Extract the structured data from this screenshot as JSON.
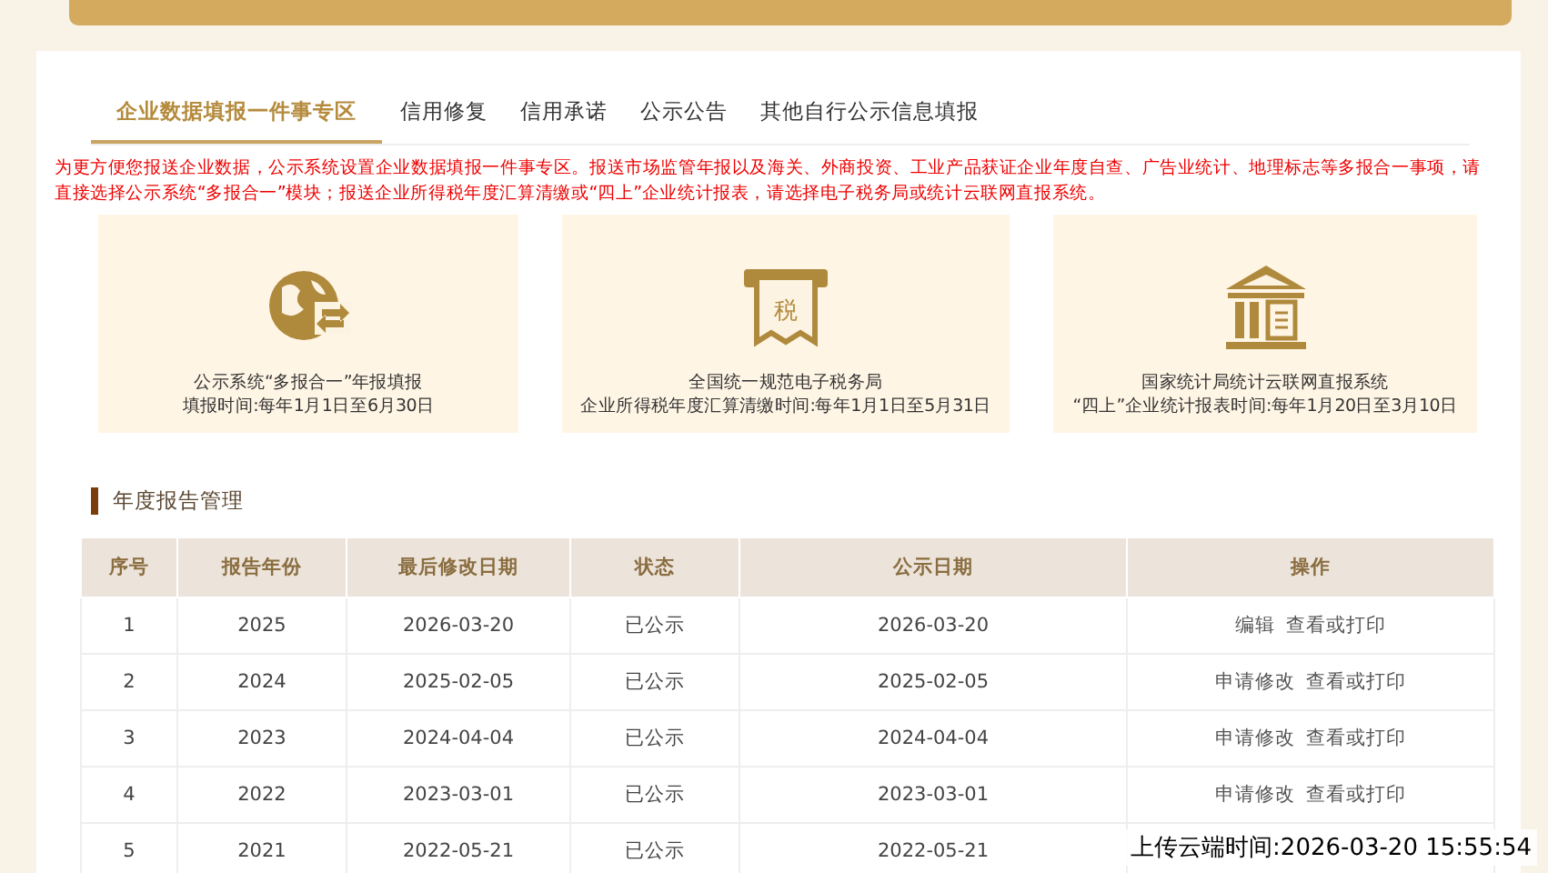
{
  "tabs": [
    {
      "label": "企业数据填报一件事专区",
      "selected": true
    },
    {
      "label": "信用修复",
      "selected": false
    },
    {
      "label": "信用承诺",
      "selected": false
    },
    {
      "label": "公示公告",
      "selected": false
    },
    {
      "label": "其他自行公示信息填报",
      "selected": false
    }
  ],
  "notice": "为更方便您报送企业数据，公示系统设置企业数据填报一件事专区。报送市场监管年报以及海关、外商投资、工业产品获证企业年度自查、广告业统计、地理标志等多报合一事项，请直接选择公示系统“多报合一”模块；报送企业所得税年度汇算清缴或“四上”企业统计报表，请选择电子税务局或统计云联网直报系统。",
  "cards": [
    {
      "kind": "globe",
      "title": "公示系统“多报合一”年报填报",
      "period": "填报时间:每年1月1日至6月30日"
    },
    {
      "kind": "tax",
      "icon_text": "税",
      "title": "全国统一规范电子税务局",
      "period": "企业所得税年度汇算清缴时间:每年1月1日至5月31日"
    },
    {
      "kind": "bank",
      "title": "国家统计局统计云联网直报系统",
      "period": "“四上”企业统计报表时间:每年1月20日至3月10日"
    }
  ],
  "section_title": "年度报告管理",
  "table": {
    "columns": [
      "序号",
      "报告年份",
      "最后修改日期",
      "状态",
      "公示日期",
      "操作"
    ],
    "rows": [
      {
        "cells": [
          "1",
          "2025",
          "2026-03-20",
          "已公示",
          "2026-03-20"
        ],
        "actions": [
          "编辑",
          "查看或打印"
        ]
      },
      {
        "cells": [
          "2",
          "2024",
          "2025-02-05",
          "已公示",
          "2025-02-05"
        ],
        "actions": [
          "申请修改",
          "查看或打印"
        ]
      },
      {
        "cells": [
          "3",
          "2023",
          "2024-04-04",
          "已公示",
          "2024-04-04"
        ],
        "actions": [
          "申请修改",
          "查看或打印"
        ]
      },
      {
        "cells": [
          "4",
          "2022",
          "2023-03-01",
          "已公示",
          "2023-03-01"
        ],
        "actions": [
          "申请修改",
          "查看或打印"
        ]
      },
      {
        "cells": [
          "5",
          "2021",
          "2022-05-21",
          "已公示",
          "2022-05-21"
        ]
      }
    ]
  },
  "overlay_timestamp": "上传云端时间:2026-03-20 15:55:54"
}
